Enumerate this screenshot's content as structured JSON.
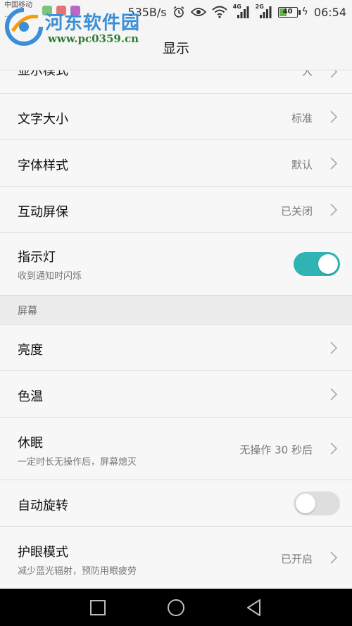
{
  "status_bar": {
    "carrier_line1": "中国移动",
    "carrier_line2": "…",
    "net_speed": "535B/s",
    "signal_4g": "4G",
    "signal_2g": "2G",
    "battery": "40",
    "time": "06:54"
  },
  "watermark": {
    "name": "河东软件园",
    "url": "www.pc0359.cn"
  },
  "header": {
    "title": "显示"
  },
  "settings": {
    "display_mode": {
      "label": "显示模式",
      "value": "大"
    },
    "font_size": {
      "label": "文字大小",
      "value": "标准"
    },
    "font_style": {
      "label": "字体样式",
      "value": "默认"
    },
    "screensaver": {
      "label": "互动屏保",
      "value": "已关闭"
    },
    "indicator": {
      "label": "指示灯",
      "sub": "收到通知时闪烁",
      "on": true
    },
    "section_screen": "屏幕",
    "brightness": {
      "label": "亮度"
    },
    "color_temp": {
      "label": "色温"
    },
    "sleep": {
      "label": "休眠",
      "sub": "一定时长无操作后，屏幕熄灭",
      "value": "无操作 30 秒后"
    },
    "auto_rotate": {
      "label": "自动旋转",
      "on": false
    },
    "eye_comfort": {
      "label": "护眼模式",
      "sub": "减少蓝光辐射，预防用眼疲劳",
      "value": "已开启"
    }
  },
  "colors": {
    "accent": "#2fb3b3",
    "background": "#f5f5f5",
    "navbar": "#000000"
  },
  "nav_icons": [
    "recents-square-icon",
    "home-circle-icon",
    "back-triangle-icon"
  ]
}
